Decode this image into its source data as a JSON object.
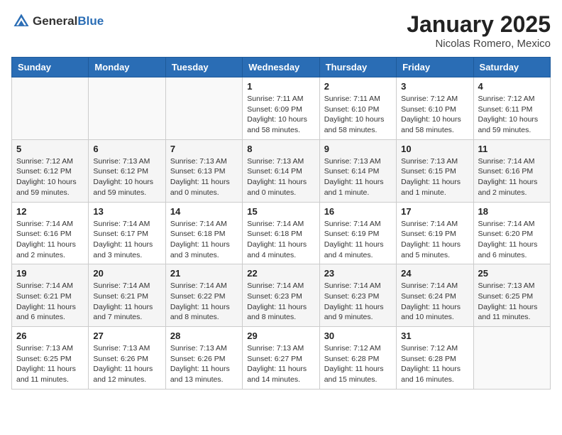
{
  "header": {
    "logo_general": "General",
    "logo_blue": "Blue",
    "title": "January 2025",
    "subtitle": "Nicolas Romero, Mexico"
  },
  "weekdays": [
    "Sunday",
    "Monday",
    "Tuesday",
    "Wednesday",
    "Thursday",
    "Friday",
    "Saturday"
  ],
  "weeks": [
    [
      {
        "day": "",
        "info": ""
      },
      {
        "day": "",
        "info": ""
      },
      {
        "day": "",
        "info": ""
      },
      {
        "day": "1",
        "info": "Sunrise: 7:11 AM\nSunset: 6:09 PM\nDaylight: 10 hours and 58 minutes."
      },
      {
        "day": "2",
        "info": "Sunrise: 7:11 AM\nSunset: 6:10 PM\nDaylight: 10 hours and 58 minutes."
      },
      {
        "day": "3",
        "info": "Sunrise: 7:12 AM\nSunset: 6:10 PM\nDaylight: 10 hours and 58 minutes."
      },
      {
        "day": "4",
        "info": "Sunrise: 7:12 AM\nSunset: 6:11 PM\nDaylight: 10 hours and 59 minutes."
      }
    ],
    [
      {
        "day": "5",
        "info": "Sunrise: 7:12 AM\nSunset: 6:12 PM\nDaylight: 10 hours and 59 minutes."
      },
      {
        "day": "6",
        "info": "Sunrise: 7:13 AM\nSunset: 6:12 PM\nDaylight: 10 hours and 59 minutes."
      },
      {
        "day": "7",
        "info": "Sunrise: 7:13 AM\nSunset: 6:13 PM\nDaylight: 11 hours and 0 minutes."
      },
      {
        "day": "8",
        "info": "Sunrise: 7:13 AM\nSunset: 6:14 PM\nDaylight: 11 hours and 0 minutes."
      },
      {
        "day": "9",
        "info": "Sunrise: 7:13 AM\nSunset: 6:14 PM\nDaylight: 11 hours and 1 minute."
      },
      {
        "day": "10",
        "info": "Sunrise: 7:13 AM\nSunset: 6:15 PM\nDaylight: 11 hours and 1 minute."
      },
      {
        "day": "11",
        "info": "Sunrise: 7:14 AM\nSunset: 6:16 PM\nDaylight: 11 hours and 2 minutes."
      }
    ],
    [
      {
        "day": "12",
        "info": "Sunrise: 7:14 AM\nSunset: 6:16 PM\nDaylight: 11 hours and 2 minutes."
      },
      {
        "day": "13",
        "info": "Sunrise: 7:14 AM\nSunset: 6:17 PM\nDaylight: 11 hours and 3 minutes."
      },
      {
        "day": "14",
        "info": "Sunrise: 7:14 AM\nSunset: 6:18 PM\nDaylight: 11 hours and 3 minutes."
      },
      {
        "day": "15",
        "info": "Sunrise: 7:14 AM\nSunset: 6:18 PM\nDaylight: 11 hours and 4 minutes."
      },
      {
        "day": "16",
        "info": "Sunrise: 7:14 AM\nSunset: 6:19 PM\nDaylight: 11 hours and 4 minutes."
      },
      {
        "day": "17",
        "info": "Sunrise: 7:14 AM\nSunset: 6:19 PM\nDaylight: 11 hours and 5 minutes."
      },
      {
        "day": "18",
        "info": "Sunrise: 7:14 AM\nSunset: 6:20 PM\nDaylight: 11 hours and 6 minutes."
      }
    ],
    [
      {
        "day": "19",
        "info": "Sunrise: 7:14 AM\nSunset: 6:21 PM\nDaylight: 11 hours and 6 minutes."
      },
      {
        "day": "20",
        "info": "Sunrise: 7:14 AM\nSunset: 6:21 PM\nDaylight: 11 hours and 7 minutes."
      },
      {
        "day": "21",
        "info": "Sunrise: 7:14 AM\nSunset: 6:22 PM\nDaylight: 11 hours and 8 minutes."
      },
      {
        "day": "22",
        "info": "Sunrise: 7:14 AM\nSunset: 6:23 PM\nDaylight: 11 hours and 8 minutes."
      },
      {
        "day": "23",
        "info": "Sunrise: 7:14 AM\nSunset: 6:23 PM\nDaylight: 11 hours and 9 minutes."
      },
      {
        "day": "24",
        "info": "Sunrise: 7:14 AM\nSunset: 6:24 PM\nDaylight: 11 hours and 10 minutes."
      },
      {
        "day": "25",
        "info": "Sunrise: 7:13 AM\nSunset: 6:25 PM\nDaylight: 11 hours and 11 minutes."
      }
    ],
    [
      {
        "day": "26",
        "info": "Sunrise: 7:13 AM\nSunset: 6:25 PM\nDaylight: 11 hours and 11 minutes."
      },
      {
        "day": "27",
        "info": "Sunrise: 7:13 AM\nSunset: 6:26 PM\nDaylight: 11 hours and 12 minutes."
      },
      {
        "day": "28",
        "info": "Sunrise: 7:13 AM\nSunset: 6:26 PM\nDaylight: 11 hours and 13 minutes."
      },
      {
        "day": "29",
        "info": "Sunrise: 7:13 AM\nSunset: 6:27 PM\nDaylight: 11 hours and 14 minutes."
      },
      {
        "day": "30",
        "info": "Sunrise: 7:12 AM\nSunset: 6:28 PM\nDaylight: 11 hours and 15 minutes."
      },
      {
        "day": "31",
        "info": "Sunrise: 7:12 AM\nSunset: 6:28 PM\nDaylight: 11 hours and 16 minutes."
      },
      {
        "day": "",
        "info": ""
      }
    ]
  ]
}
